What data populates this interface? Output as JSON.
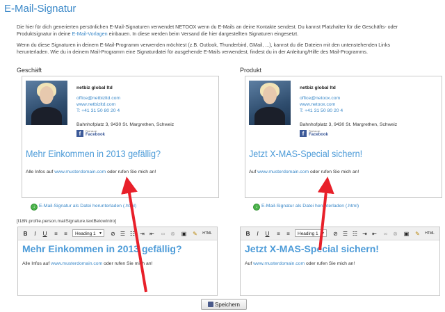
{
  "page": {
    "title": "E-Mail-Signatur"
  },
  "intro": {
    "p1_a": "Die hier für dich generierten persönlichen E-Mail-Signaturen verwendet NETOOX wenn du E-Mails an deine Kontakte sendest. Du kannst Platzhalter für die Geschäfts- oder",
    "p1_b": "Produktsignatur in deine ",
    "p1_link": "E-Mail-Vorlagen",
    "p1_c": " einbauen. In diese werden beim Versand die hier dargestellten Signaturen eingesetzt.",
    "p2_a": "Wenn du diese Signaturen in deinem E-Mail-Programm verwenden möchtest (z.B. Outlook, Thunderbird, GMail, ...), kannst du die Dateien mit den untenstehenden Links",
    "p2_b": "herunterladen. Wie du in deinem Mail-Programm eine Signaturdatei für ausgehende E-Mails verwendest, findest du in der Anleitung/Hilfe des Mail-Programms."
  },
  "columns": [
    {
      "label": "Geschäft",
      "card": {
        "company": "netbiz global ltd",
        "email": "office@netbizltd.com",
        "web": "www.netbizltd.com",
        "phone": "T: +41 31 50 80 20 4",
        "address": "Bahnhofplatz 3, 9430 St. Margrethen, Schweiz",
        "fb_small": "Find us on",
        "fb_name": "Facebook",
        "headline": "Mehr Einkommen in 2013 gefällig?",
        "sub_a": "Alle Infos auf ",
        "sub_link": "www.musterdomain.com",
        "sub_b": " oder rufen Sie mich an!"
      },
      "download": "E-Mail-Signatur als Datei herunterladen (.html)",
      "editor": {
        "style_value": "Heading 1",
        "headline": "Mehr Einkommen in 2013 gefällig?",
        "sub_a": "Alle Infos auf ",
        "sub_link": "www.musterdomain.com",
        "sub_b": " oder rufen Sie mich an!"
      }
    },
    {
      "label": "Produkt",
      "card": {
        "company": "netbiz global ltd",
        "email": "office@netoox.com",
        "web": "www.netoox.com",
        "phone": "T: +41 31 50 80 20 4",
        "address": "Bahnhofplatz 3, 9430 St. Margrethen, Schweiz",
        "fb_small": "Find us on",
        "fb_name": "Facebook",
        "headline": "Jetzt X-MAS-Special sichern!",
        "sub_a": "Auf ",
        "sub_link": "www.musterdomain.com",
        "sub_b": " oder rufen Sie mich an!"
      },
      "download": "E-Mail-Signatur als Datei herunterladen (.html)",
      "editor": {
        "style_value": "Heading 1",
        "headline": "Jetzt X-MAS-Special sichern!",
        "sub_a": "Auf ",
        "sub_link": "www.musterdomain.com",
        "sub_b": " oder rufen Sie mich an!"
      }
    }
  ],
  "i18n_key": "[I18N.profile.person.mailSignature.textBelowIntro]",
  "toolbar": {
    "bold": "B",
    "italic": "I",
    "underline": "U",
    "source": "HTML"
  },
  "save_label": "Speichern",
  "arrow_color": "#e8202a",
  "accent_color": "#4c9bd8"
}
